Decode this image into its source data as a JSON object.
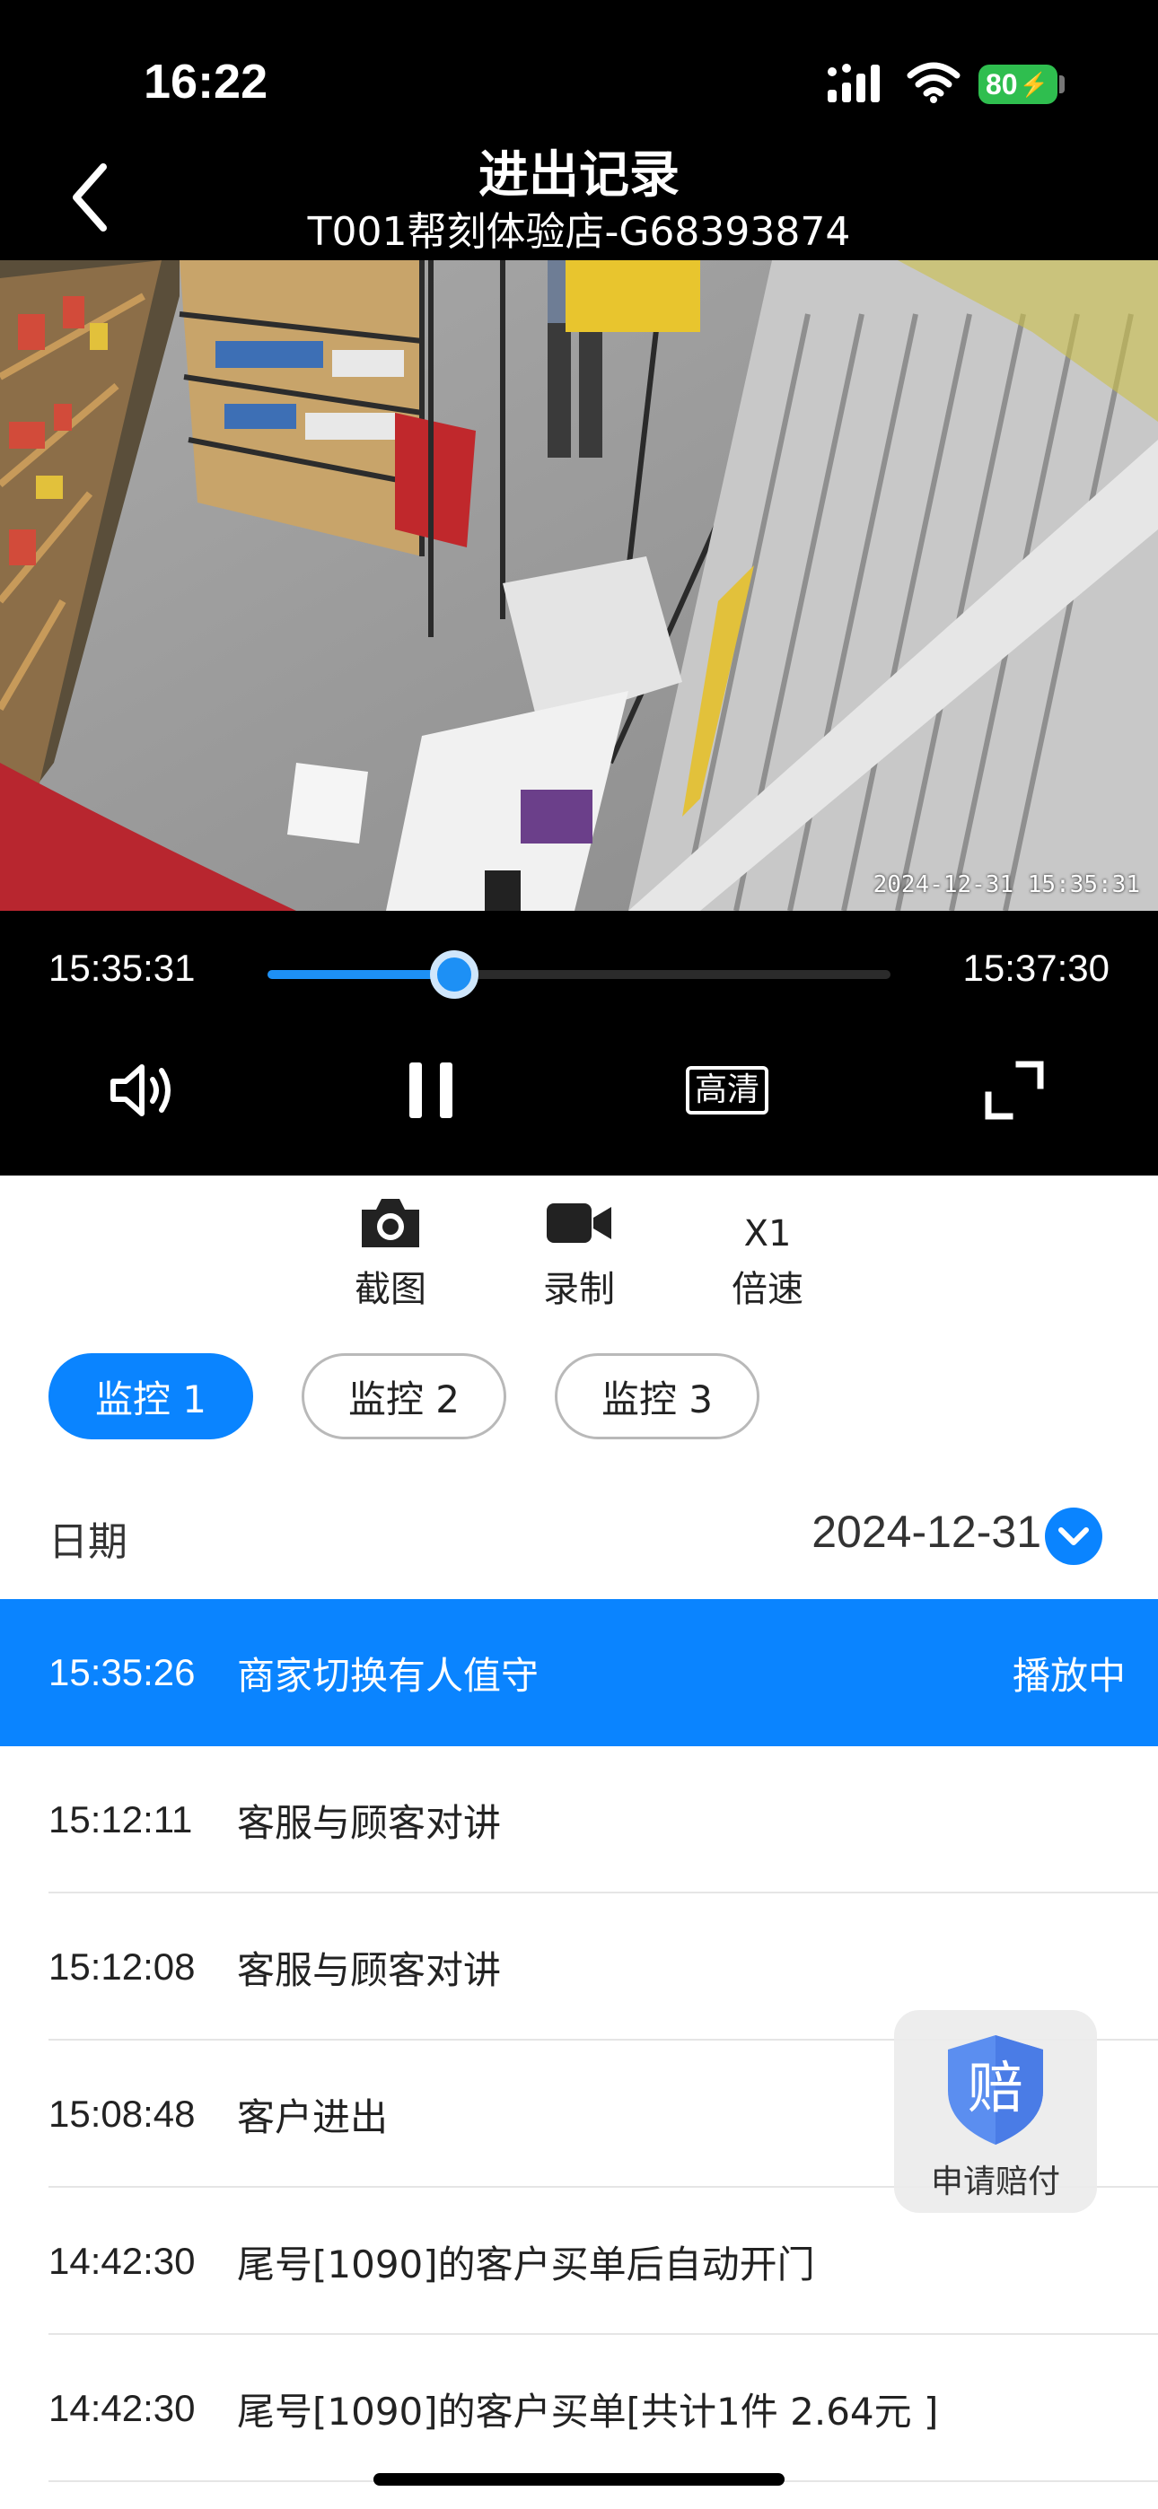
{
  "status_bar": {
    "time": "16:22",
    "battery": "80",
    "icons": [
      "signal-icon",
      "wifi-icon",
      "battery-icon"
    ]
  },
  "nav": {
    "title": "进出记录",
    "subtitle": "T001帮刻体验店-G68393874",
    "back_icon": "chevron-left-icon"
  },
  "video": {
    "timestamp": "2024-12-31 15:35:31"
  },
  "player": {
    "current_time": "15:35:31",
    "total_time": "15:37:30",
    "progress": 0.3,
    "quality_label": "高清",
    "icons": [
      "volume-icon",
      "pause-icon",
      "quality-icon",
      "fullscreen-icon"
    ]
  },
  "tools": {
    "screenshot_label": "截图",
    "record_label": "录制",
    "speed_value": "X1",
    "speed_label": "倍速"
  },
  "cameras": {
    "active_index": 0,
    "tabs": [
      "监控 1",
      "监控 2",
      "监控 3"
    ]
  },
  "date": {
    "label": "日期",
    "value": "2024-12-31"
  },
  "records": [
    {
      "time": "15:35:26",
      "text": "商家切换有人值守",
      "status": "播放中"
    },
    {
      "time": "15:12:11",
      "text": "客服与顾客对讲"
    },
    {
      "time": "15:12:08",
      "text": "客服与顾客对讲"
    },
    {
      "time": "15:08:48",
      "text": "客户进出"
    },
    {
      "time": "14:42:30",
      "text": "尾号[1090]的客户买单后自动开门"
    },
    {
      "time": "14:42:30",
      "text": "尾号[1090]的客户买单[共计1件 2.64元 ]"
    }
  ],
  "claim": {
    "icon_char": "赔",
    "label": "申请赔付"
  },
  "colors": {
    "accent": "#0a84ff",
    "battery": "#2fbe4f",
    "black": "#000000"
  }
}
